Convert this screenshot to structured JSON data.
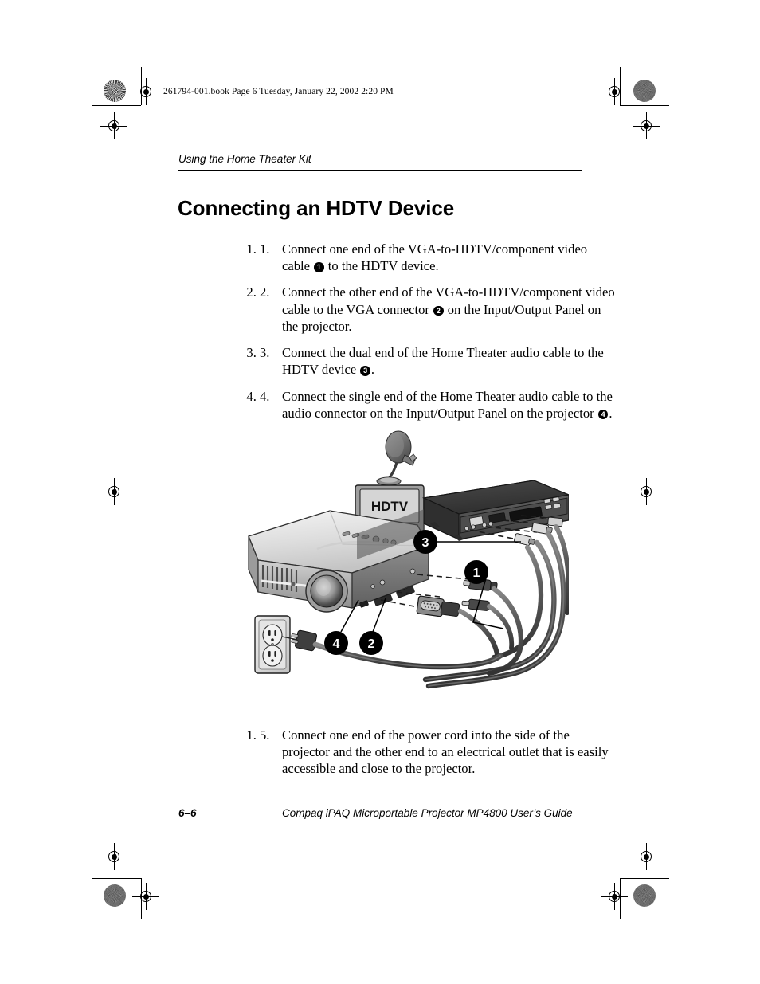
{
  "print_header": {
    "text": "261794-001.book  Page 6  Tuesday, January 22, 2002  2:20 PM"
  },
  "running_head": {
    "text": "Using the Home Theater Kit"
  },
  "heading": {
    "text": "Connecting an HDTV Device"
  },
  "steps": [
    {
      "num": "1.",
      "parts": [
        {
          "t": "text",
          "v": "Connect one end of the VGA-to-HDTV/component video cable "
        },
        {
          "t": "callout",
          "v": "1"
        },
        {
          "t": "text",
          "v": " to the HDTV device."
        }
      ]
    },
    {
      "num": "2.",
      "parts": [
        {
          "t": "text",
          "v": "Connect the other end of the VGA-to-HDTV/component video cable to the VGA connector "
        },
        {
          "t": "callout",
          "v": "2"
        },
        {
          "t": "text",
          "v": " on the Input/Output Panel on the projector."
        }
      ]
    },
    {
      "num": "3.",
      "parts": [
        {
          "t": "text",
          "v": "Connect the dual end of the Home Theater audio cable to the HDTV device "
        },
        {
          "t": "callout",
          "v": "3"
        },
        {
          "t": "text",
          "v": "."
        }
      ]
    },
    {
      "num": "4.",
      "parts": [
        {
          "t": "text",
          "v": "Connect the single end of the Home Theater audio cable to the audio connector on the Input/Output Panel on the projector "
        },
        {
          "t": "callout",
          "v": "4"
        },
        {
          "t": "text",
          "v": "."
        }
      ]
    }
  ],
  "steps_after_figure": [
    {
      "num": "5.",
      "parts": [
        {
          "t": "text",
          "v": "Connect one end of the power cord into the side of the projector and the other end to an electrical outlet that is easily accessible and close to the projector."
        }
      ]
    }
  ],
  "figure": {
    "alt": "HDTV connection diagram",
    "hdtv_screen_label": "HDTV",
    "callouts": [
      {
        "label": "3",
        "role": "home-theater-audio-cable-dual-end-at-hdtv"
      },
      {
        "label": "1",
        "role": "vga-to-hdtv-component-video-cable"
      },
      {
        "label": "4",
        "role": "audio-connector-on-input-output-panel"
      },
      {
        "label": "2",
        "role": "vga-connector-on-input-output-panel"
      }
    ],
    "devices": [
      "satellite-dish",
      "hdtv-television",
      "hdtv-set-top-receiver",
      "projector",
      "wall-outlet"
    ]
  },
  "footer": {
    "page_number": "6–6",
    "guide_title": "Compaq iPAQ Microportable Projector MP4800 User’s Guide"
  },
  "colors": {
    "ink": "#000000",
    "paper": "#ffffff",
    "projector_light": "#e8e8e8",
    "projector_mid": "#b8b8b8",
    "projector_dark": "#6e6e6e",
    "device_dark": "#3c3c3c",
    "cable_gray": "#555555",
    "screen_gray": "#b4b4b4"
  }
}
